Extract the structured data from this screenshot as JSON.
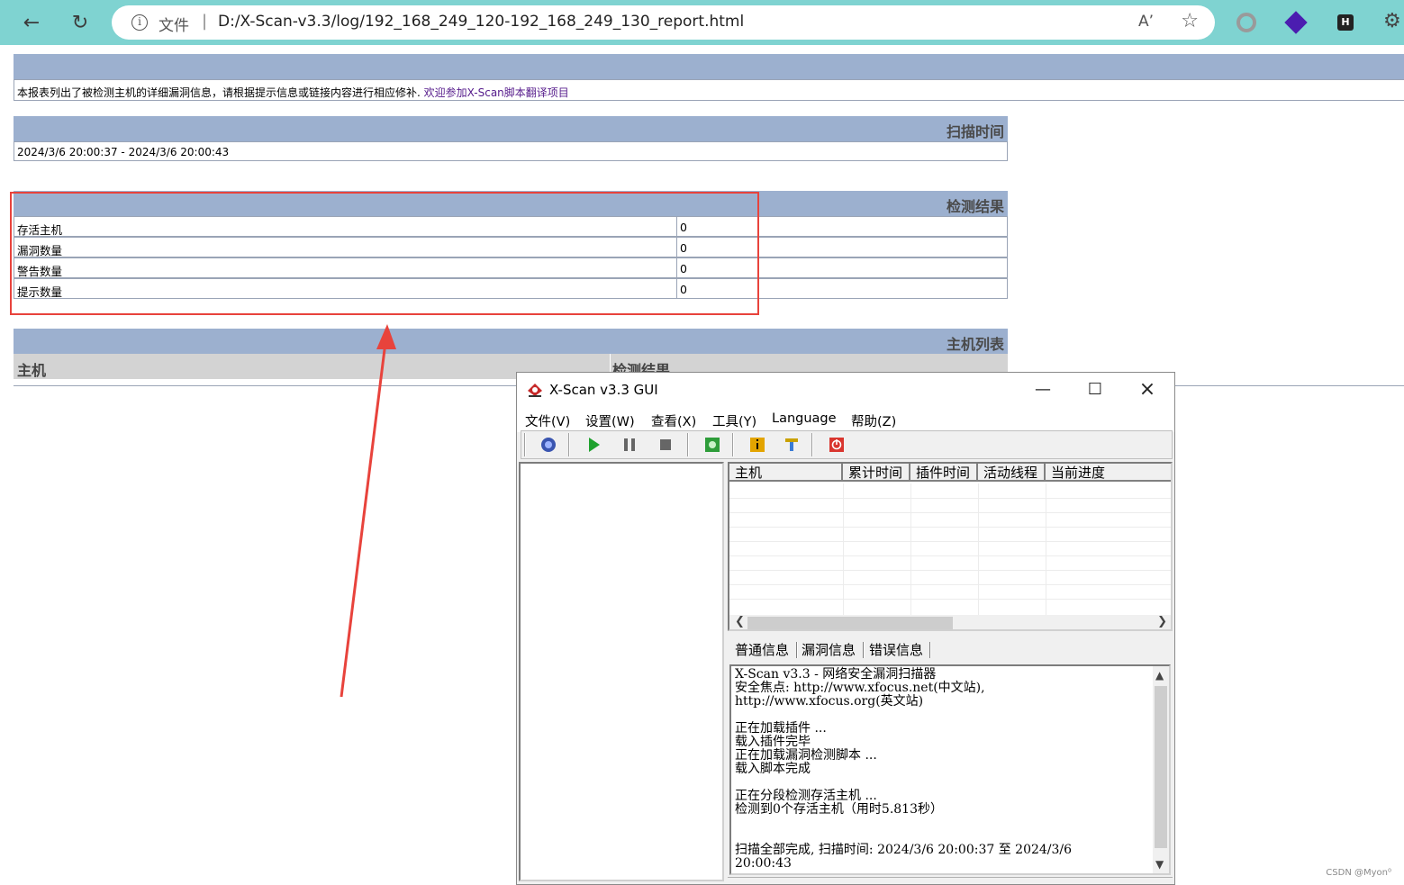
{
  "browser": {
    "file_label": "文件",
    "url": "D:/X-Scan-v3.3/log/192_168_249_120-192_168_249_130_report.html"
  },
  "report": {
    "intro_text": "本报表列出了被检测主机的详细漏洞信息，请根据提示信息或链接内容进行相应修补.",
    "intro_link": "欢迎参加X-Scan脚本翻译项目",
    "scan_time_header": "扫描时间",
    "scan_time_value": "2024/3/6 20:00:37 - 2024/3/6 20:00:43",
    "results_header": "检测结果",
    "results": [
      {
        "label": "存活主机",
        "value": "0"
      },
      {
        "label": "漏洞数量",
        "value": "0"
      },
      {
        "label": "警告数量",
        "value": "0"
      },
      {
        "label": "提示数量",
        "value": "0"
      }
    ],
    "host_list_header": "主机列表",
    "host_col_host": "主机",
    "host_col_result": "检测结果"
  },
  "xscan": {
    "title": "X-Scan v3.3 GUI",
    "menu": [
      "文件(V)",
      "设置(W)",
      "查看(X)",
      "工具(Y)",
      "Language",
      "帮助(Z)"
    ],
    "columns": [
      "主机",
      "累计时间",
      "插件时间",
      "活动线程",
      "当前进度"
    ],
    "tabs": [
      "普通信息",
      "漏洞信息",
      "错误信息"
    ],
    "log_lines": [
      "X-Scan v3.3 - 网络安全漏洞扫描器",
      "安全焦点: http://www.xfocus.net(中文站),",
      "http://www.xfocus.org(英文站)",
      "",
      "正在加载插件 ...",
      "载入插件完毕",
      "正在加载漏洞检测脚本 ...",
      "载入脚本完成",
      "",
      "正在分段检测存活主机 ...",
      "检测到0个存活主机（用时5.813秒）",
      "",
      "",
      "扫描全部完成, 扫描时间: 2024/3/6 20:00:37 至 2024/3/6",
      "20:00:43"
    ]
  },
  "watermark": "CSDN @Myon⁰",
  "colors": {
    "browser_chrome": "#7fd3d1",
    "report_band": "#9cb0cf",
    "annotation_red": "#e8433c",
    "link_purple": "#551a8b"
  }
}
